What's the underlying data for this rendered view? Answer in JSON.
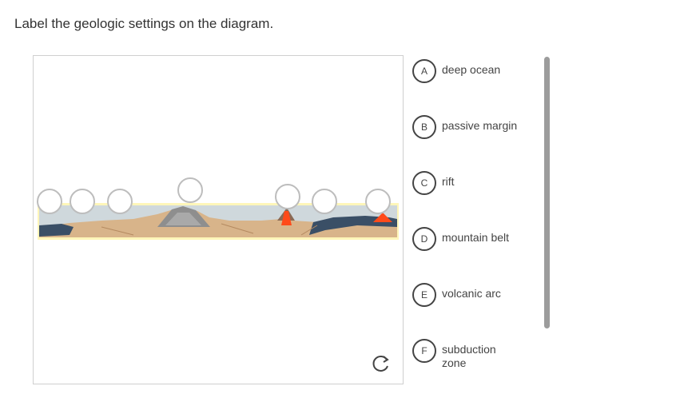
{
  "question": {
    "prompt": "Label the geologic settings on the diagram."
  },
  "diagram": {
    "drop_target_count": 7,
    "colors": {
      "sand": "#d8b48a",
      "mountain": "#8e8e8e",
      "ocean": "#3a4f66",
      "lava": "#ff4a1a",
      "highlight": "#fff4a8"
    }
  },
  "labels": [
    {
      "letter": "A",
      "text": "deep ocean"
    },
    {
      "letter": "B",
      "text": "passive margin"
    },
    {
      "letter": "C",
      "text": "rift"
    },
    {
      "letter": "D",
      "text": "mountain belt"
    },
    {
      "letter": "E",
      "text": "volcanic arc"
    },
    {
      "letter": "F",
      "text": "subduction zone"
    }
  ],
  "controls": {
    "reset_icon": "rotate-clockwise-icon"
  }
}
